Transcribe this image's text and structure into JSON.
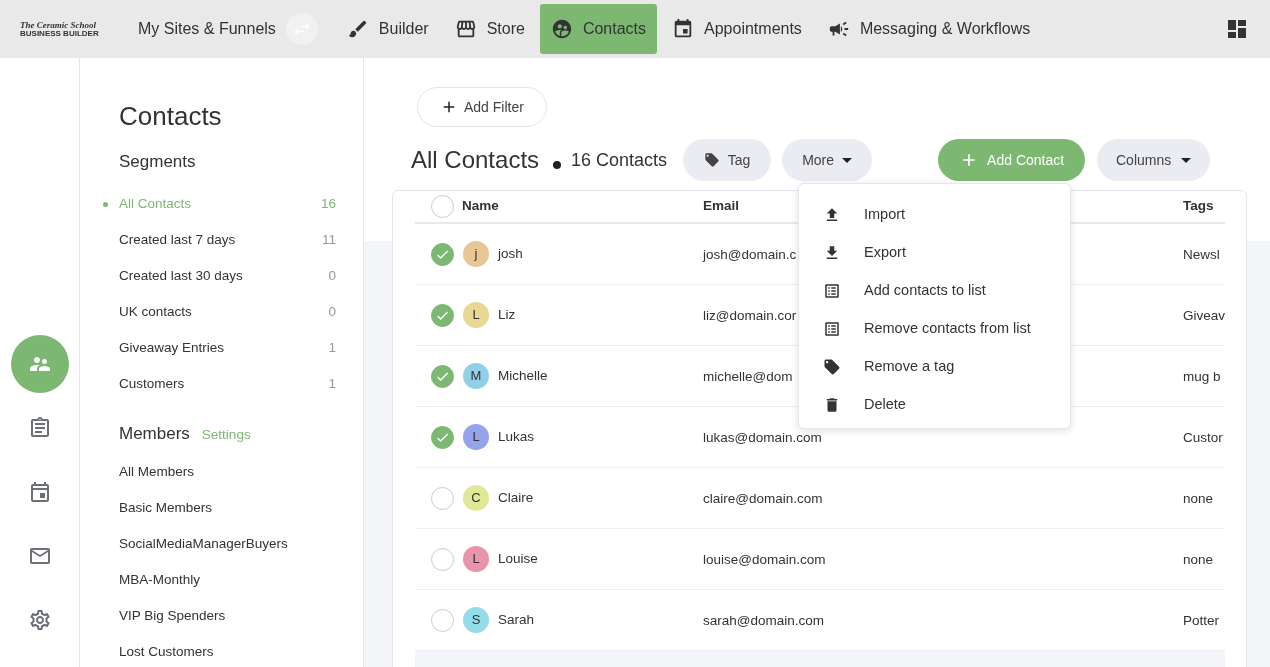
{
  "logo": {
    "line1": "The Ceramic School",
    "line2": "BUSINESS BUILDER"
  },
  "site_switcher": {
    "label": "My Sites & Funnels"
  },
  "nav": [
    {
      "label": "Builder",
      "selected": false
    },
    {
      "label": "Store",
      "selected": false
    },
    {
      "label": "Contacts",
      "selected": true
    },
    {
      "label": "Appointments",
      "selected": false
    },
    {
      "label": "Messaging & Workflows",
      "selected": false
    }
  ],
  "rail": [
    {
      "selected": true
    },
    {
      "selected": false
    },
    {
      "selected": false
    },
    {
      "selected": false
    },
    {
      "selected": false
    }
  ],
  "sidebar": {
    "title": "Contacts",
    "segments_heading": "Segments",
    "segments": [
      {
        "name": "All Contacts",
        "count": "16",
        "selected": true
      },
      {
        "name": "Created last 7 days",
        "count": "11",
        "selected": false
      },
      {
        "name": "Created last 30 days",
        "count": "0",
        "selected": false
      },
      {
        "name": "UK contacts",
        "count": "0",
        "selected": false
      },
      {
        "name": "Giveaway Entries",
        "count": "1",
        "selected": false
      },
      {
        "name": "Customers",
        "count": "1",
        "selected": false
      }
    ],
    "members_heading": "Members",
    "members_link": "Settings",
    "members": [
      "All Members",
      "Basic Members",
      "SocialMediaManagerBuyers",
      "MBA-Monthly",
      "VIP Big Spenders",
      "Lost Customers"
    ]
  },
  "toolbar": {
    "add_filter": "Add Filter",
    "title": "All Contacts",
    "count": "16 Contacts",
    "tag": "Tag",
    "more": "More",
    "add_contact": "Add Contact",
    "columns": "Columns"
  },
  "table": {
    "select_all_checked": false,
    "columns": [
      "Name",
      "Email",
      "Tags"
    ],
    "rows": [
      {
        "initial": "j",
        "name": "josh",
        "email": "josh@domain.c",
        "tags": "Newsl",
        "checked": true,
        "color": "#e8c796"
      },
      {
        "initial": "L",
        "name": "Liz",
        "email": "liz@domain.cor",
        "tags": "Giveav",
        "checked": true,
        "color": "#e8d894"
      },
      {
        "initial": "M",
        "name": "Michelle",
        "email": "michelle@dom",
        "tags": "mug b",
        "checked": true,
        "color": "#92cfe8"
      },
      {
        "initial": "L",
        "name": "Lukas",
        "email": "lukas@domain.com",
        "tags": "Custor",
        "checked": true,
        "color": "#94a3ea"
      },
      {
        "initial": "C",
        "name": "Claire",
        "email": "claire@domain.com",
        "tags": "none",
        "checked": false,
        "color": "#dfe896"
      },
      {
        "initial": "L",
        "name": "Louise",
        "email": "louise@domain.com",
        "tags": "none",
        "checked": false,
        "color": "#e894ab"
      },
      {
        "initial": "S",
        "name": "Sarah",
        "email": "sarah@domain.com",
        "tags": "Potter",
        "checked": false,
        "color": "#94dce8"
      }
    ]
  },
  "more_menu": [
    "Import",
    "Export",
    "Add contacts to list",
    "Remove contacts from list",
    "Remove a tag",
    "Delete"
  ]
}
